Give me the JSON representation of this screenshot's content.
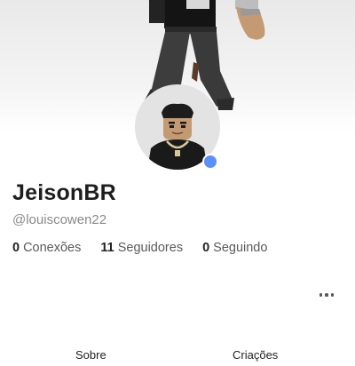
{
  "profile": {
    "display_name": "JeisonBR",
    "username": "@louiscowen22",
    "online_status_color": "#5b8ff9",
    "presence": "online"
  },
  "stats": [
    {
      "count": "0",
      "label": "Conexões"
    },
    {
      "count": "11",
      "label": "Seguidores"
    },
    {
      "count": "0",
      "label": "Seguindo"
    }
  ],
  "actions": {
    "more_icon": "ellipsis-icon"
  },
  "tabs": [
    {
      "label": "Sobre"
    },
    {
      "label": "Criações"
    }
  ],
  "colors": {
    "accent": "#5b8ff9",
    "text_primary": "#1e1e1e",
    "text_secondary": "#8a8a8a"
  }
}
